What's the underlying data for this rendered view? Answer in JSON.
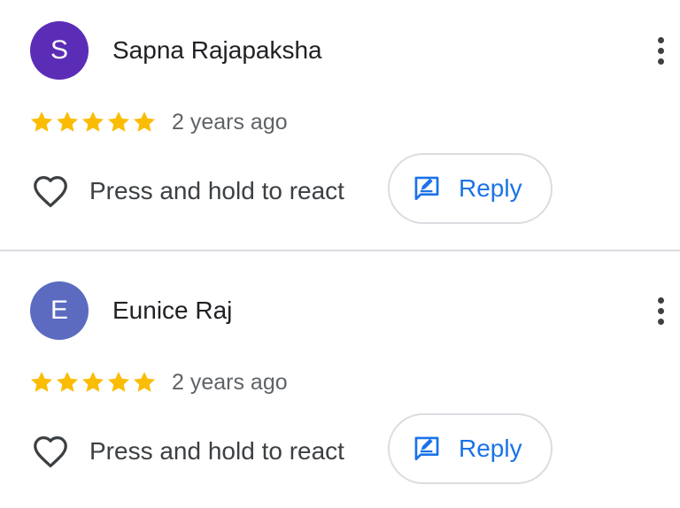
{
  "colors": {
    "star": "#fbbc04",
    "reply_accent": "#1a73e8",
    "divider": "#dadce0"
  },
  "reviews": [
    {
      "avatar_letter": "S",
      "avatar_color": "#5b2db6",
      "name": "Sapna Rajapaksha",
      "rating": 5,
      "time": "2 years ago",
      "react_label": "Press and hold to react",
      "reply_label": "Reply",
      "more_icon": "more-vert-icon"
    },
    {
      "avatar_letter": "E",
      "avatar_color": "#5c6bc0",
      "name": "Eunice Raj",
      "rating": 5,
      "time": "2 years ago",
      "react_label": "Press and hold to react",
      "reply_label": "Reply",
      "more_icon": "more-vert-icon"
    }
  ]
}
